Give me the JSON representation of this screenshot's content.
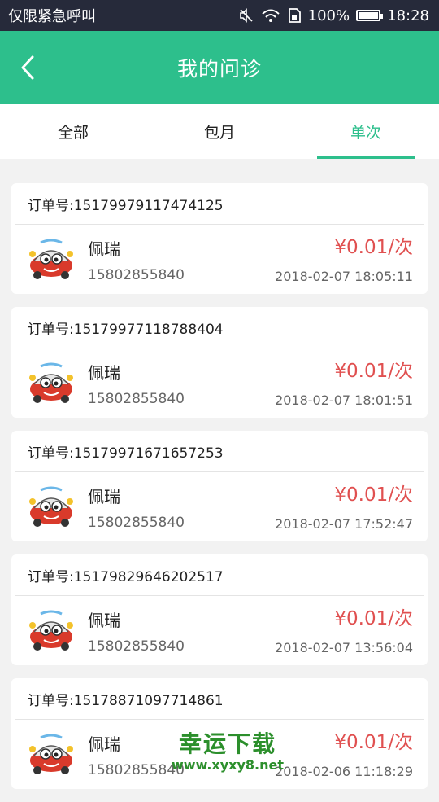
{
  "status_bar": {
    "carrier_text": "仅限紧急呼叫",
    "battery_percent": "100%",
    "time": "18:28"
  },
  "header": {
    "title": "我的问诊"
  },
  "tabs": [
    {
      "label": "全部",
      "active": false
    },
    {
      "label": "包月",
      "active": false
    },
    {
      "label": "单次",
      "active": true
    }
  ],
  "orders": [
    {
      "order_label": "订单号:15179979117474125",
      "name": "佩瑞",
      "phone": "15802855840",
      "price": "¥0.01/次",
      "time": "2018-02-07 18:05:11"
    },
    {
      "order_label": "订单号:15179977118788404",
      "name": "佩瑞",
      "phone": "15802855840",
      "price": "¥0.01/次",
      "time": "2018-02-07 18:01:51"
    },
    {
      "order_label": "订单号:15179971671657253",
      "name": "佩瑞",
      "phone": "15802855840",
      "price": "¥0.01/次",
      "time": "2018-02-07 17:52:47"
    },
    {
      "order_label": "订单号:15179829646202517",
      "name": "佩瑞",
      "phone": "15802855840",
      "price": "¥0.01/次",
      "time": "2018-02-07 13:56:04"
    },
    {
      "order_label": "订单号:15178871097714861",
      "name": "佩瑞",
      "phone": "15802855840",
      "price": "¥0.01/次",
      "time": "2018-02-06 11:18:29"
    }
  ],
  "watermark": {
    "title": "幸运下载",
    "url": "www.xyxy8.net"
  },
  "colors": {
    "accent": "#2dbf8c",
    "price": "#e05050",
    "status_bar": "#262a3a"
  },
  "icons": [
    "back-arrow-icon",
    "mute-icon",
    "wifi-icon",
    "sim-icon",
    "battery-icon",
    "car-avatar-icon"
  ]
}
